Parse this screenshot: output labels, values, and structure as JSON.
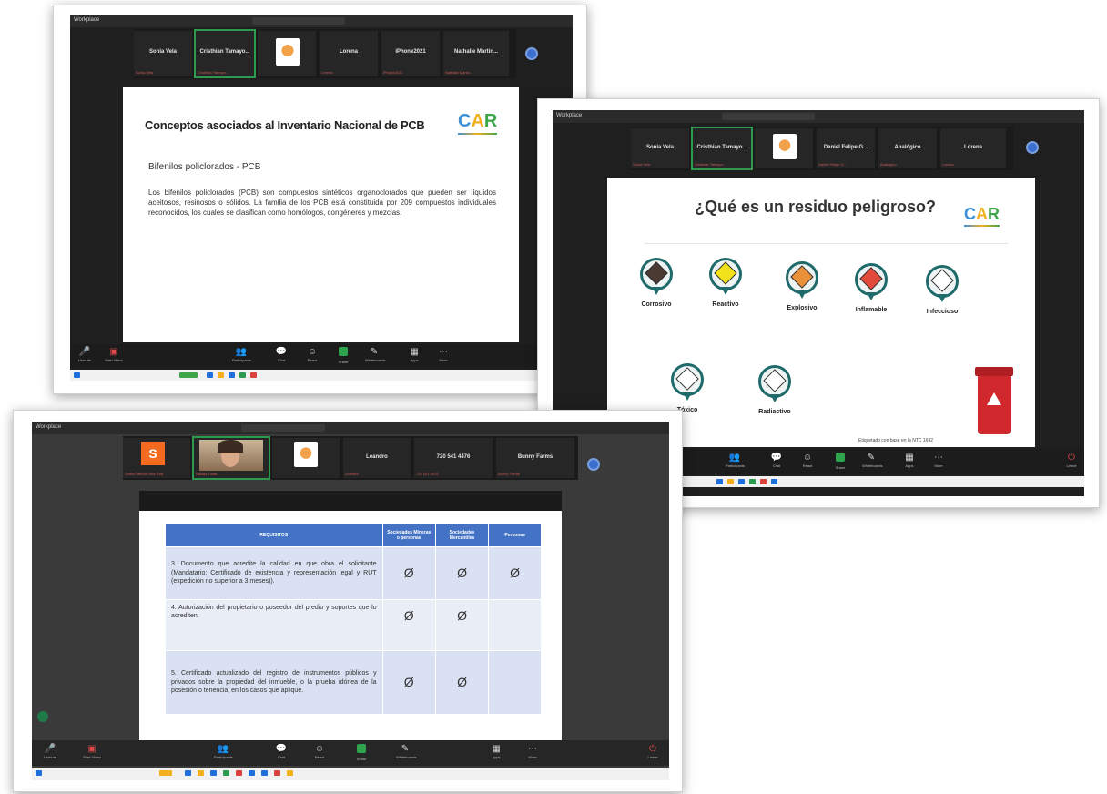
{
  "shot1": {
    "window_title": "Workplace",
    "participants": [
      {
        "name": "Sonia Vela",
        "sub": "Sonia Vela"
      },
      {
        "name": "Cristhian Tamayo...",
        "sub": "Cristhian Tamayo...",
        "active": true
      },
      {
        "name": "",
        "sub": "",
        "logo": true
      },
      {
        "name": "Lorena",
        "sub": "Lorena"
      },
      {
        "name": "iPhone2021",
        "sub": "iPhone2021"
      },
      {
        "name": "Nathalie Martin...",
        "sub": "Nathalie Martin..."
      }
    ],
    "slide": {
      "title": "Conceptos asociados al Inventario Nacional de PCB",
      "subtitle": "Bifenilos policlorados - PCB",
      "body": "Los bifenilos policlorados (PCB) son compuestos sintéticos organoclorados que pueden ser líquidos aceitosos, resinosos o sólidos. La familia de los PCB está constituida por 209 compuestos individuales reconocidos, los cuales se clasifican como homólogos, congéneres y mezclas."
    },
    "logo": {
      "c": "C",
      "a": "A",
      "r": "R"
    }
  },
  "shot2": {
    "window_title": "Workplace",
    "participants": [
      {
        "name": "Sonia Vela",
        "sub": "Sonia Vela"
      },
      {
        "name": "Cristhian Tamayo...",
        "sub": "Cristhian Tamayo...",
        "active": true
      },
      {
        "name": "",
        "sub": "",
        "logo": true
      },
      {
        "name": "Daniel Felipe G...",
        "sub": "Daniel Felipe G..."
      },
      {
        "name": "Analógico",
        "sub": "Analógico"
      },
      {
        "name": "Lorena",
        "sub": "Lorena"
      }
    ],
    "slide": {
      "title": "¿Qué es un residuo peligroso?",
      "hazards": [
        {
          "label": "Corrosivo",
          "color": "#4a3a32"
        },
        {
          "label": "Reactivo",
          "color": "#f1e21b"
        },
        {
          "label": "Explosivo",
          "color": "#e8913a"
        },
        {
          "label": "Inflamable",
          "color": "#e24a3b"
        },
        {
          "label": "Infeccioso",
          "color": "#ffffff"
        },
        {
          "label": "Tóxico",
          "color": "#ffffff"
        },
        {
          "label": "Radiactivo",
          "color": "#ffffff"
        }
      ],
      "footnote": "Etiquetado con base en la NTC 1692"
    },
    "logo": {
      "c": "C",
      "a": "A",
      "r": "R"
    }
  },
  "shot3": {
    "window_title": "Workplace",
    "participants": [
      {
        "name": "S",
        "sub": "Sonia Patricia Vela Roa",
        "avatar": "#f26b21"
      },
      {
        "name": "",
        "sub": "Natalia Tobar",
        "video": true,
        "active": true
      },
      {
        "name": "",
        "sub": "",
        "logo": true
      },
      {
        "name": "Leandro",
        "sub": "Leandro"
      },
      {
        "name": "720 541 4476",
        "sub": "720 541 4476"
      },
      {
        "name": "Bunny Farms",
        "sub": "Bunny Farms"
      }
    ],
    "table": {
      "headers": [
        "REQUISITOS",
        "Sociedades Mineras o personas",
        "Sociedades Mercantiles",
        "Personas"
      ],
      "rows": [
        {
          "text": "3. Documento que acredite la calidad en que obra el solicitante (Mandatario: Certificado de existencia y representación legal y RUT (expedición no superior a 3 meses)).",
          "marks": [
            "Ø",
            "Ø",
            "Ø"
          ]
        },
        {
          "text": "4. Autorización del propietario o poseedor del predio y soportes que lo acrediten.",
          "marks": [
            "Ø",
            "Ø",
            ""
          ]
        },
        {
          "text": "5. Certificado actualizado del registro de instrumentos públicos y privados sobre la propiedad del inmueble, o la prueba idónea de la posesión o tenencia, en los casos que aplique.",
          "marks": [
            "Ø",
            "Ø",
            ""
          ]
        }
      ]
    }
  },
  "toolbar": {
    "items": [
      "Unmute",
      "Start Video",
      "Participants",
      "Chat",
      "React",
      "Share",
      "Whiteboards",
      "Apps",
      "More",
      "Leave"
    ]
  },
  "colors": {
    "zoom_bg": "#1f1f1f",
    "accent_green": "#2da44e",
    "table_header": "#4472c4",
    "table_row": "#d9e1f2"
  }
}
